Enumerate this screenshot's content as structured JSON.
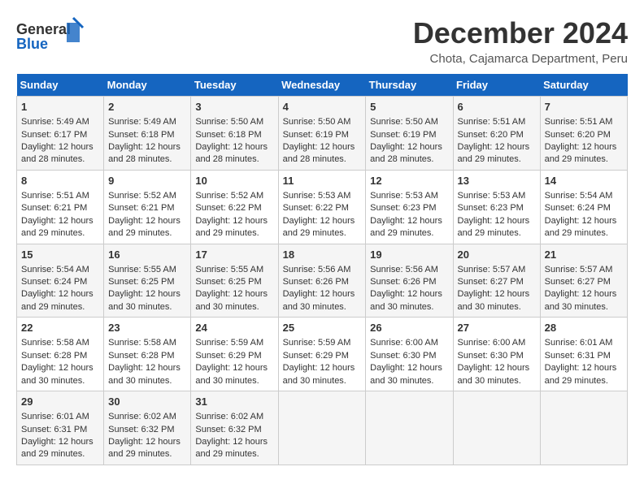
{
  "logo": {
    "general": "General",
    "blue": "Blue"
  },
  "title": "December 2024",
  "location": "Chota, Cajamarca Department, Peru",
  "days_of_week": [
    "Sunday",
    "Monday",
    "Tuesday",
    "Wednesday",
    "Thursday",
    "Friday",
    "Saturday"
  ],
  "weeks": [
    [
      {
        "day": "1",
        "sunrise": "5:49 AM",
        "sunset": "6:17 PM",
        "daylight": "12 hours and 28 minutes."
      },
      {
        "day": "2",
        "sunrise": "5:49 AM",
        "sunset": "6:18 PM",
        "daylight": "12 hours and 28 minutes."
      },
      {
        "day": "3",
        "sunrise": "5:50 AM",
        "sunset": "6:18 PM",
        "daylight": "12 hours and 28 minutes."
      },
      {
        "day": "4",
        "sunrise": "5:50 AM",
        "sunset": "6:19 PM",
        "daylight": "12 hours and 28 minutes."
      },
      {
        "day": "5",
        "sunrise": "5:50 AM",
        "sunset": "6:19 PM",
        "daylight": "12 hours and 28 minutes."
      },
      {
        "day": "6",
        "sunrise": "5:51 AM",
        "sunset": "6:20 PM",
        "daylight": "12 hours and 29 minutes."
      },
      {
        "day": "7",
        "sunrise": "5:51 AM",
        "sunset": "6:20 PM",
        "daylight": "12 hours and 29 minutes."
      }
    ],
    [
      {
        "day": "8",
        "sunrise": "5:51 AM",
        "sunset": "6:21 PM",
        "daylight": "12 hours and 29 minutes."
      },
      {
        "day": "9",
        "sunrise": "5:52 AM",
        "sunset": "6:21 PM",
        "daylight": "12 hours and 29 minutes."
      },
      {
        "day": "10",
        "sunrise": "5:52 AM",
        "sunset": "6:22 PM",
        "daylight": "12 hours and 29 minutes."
      },
      {
        "day": "11",
        "sunrise": "5:53 AM",
        "sunset": "6:22 PM",
        "daylight": "12 hours and 29 minutes."
      },
      {
        "day": "12",
        "sunrise": "5:53 AM",
        "sunset": "6:23 PM",
        "daylight": "12 hours and 29 minutes."
      },
      {
        "day": "13",
        "sunrise": "5:53 AM",
        "sunset": "6:23 PM",
        "daylight": "12 hours and 29 minutes."
      },
      {
        "day": "14",
        "sunrise": "5:54 AM",
        "sunset": "6:24 PM",
        "daylight": "12 hours and 29 minutes."
      }
    ],
    [
      {
        "day": "15",
        "sunrise": "5:54 AM",
        "sunset": "6:24 PM",
        "daylight": "12 hours and 29 minutes."
      },
      {
        "day": "16",
        "sunrise": "5:55 AM",
        "sunset": "6:25 PM",
        "daylight": "12 hours and 30 minutes."
      },
      {
        "day": "17",
        "sunrise": "5:55 AM",
        "sunset": "6:25 PM",
        "daylight": "12 hours and 30 minutes."
      },
      {
        "day": "18",
        "sunrise": "5:56 AM",
        "sunset": "6:26 PM",
        "daylight": "12 hours and 30 minutes."
      },
      {
        "day": "19",
        "sunrise": "5:56 AM",
        "sunset": "6:26 PM",
        "daylight": "12 hours and 30 minutes."
      },
      {
        "day": "20",
        "sunrise": "5:57 AM",
        "sunset": "6:27 PM",
        "daylight": "12 hours and 30 minutes."
      },
      {
        "day": "21",
        "sunrise": "5:57 AM",
        "sunset": "6:27 PM",
        "daylight": "12 hours and 30 minutes."
      }
    ],
    [
      {
        "day": "22",
        "sunrise": "5:58 AM",
        "sunset": "6:28 PM",
        "daylight": "12 hours and 30 minutes."
      },
      {
        "day": "23",
        "sunrise": "5:58 AM",
        "sunset": "6:28 PM",
        "daylight": "12 hours and 30 minutes."
      },
      {
        "day": "24",
        "sunrise": "5:59 AM",
        "sunset": "6:29 PM",
        "daylight": "12 hours and 30 minutes."
      },
      {
        "day": "25",
        "sunrise": "5:59 AM",
        "sunset": "6:29 PM",
        "daylight": "12 hours and 30 minutes."
      },
      {
        "day": "26",
        "sunrise": "6:00 AM",
        "sunset": "6:30 PM",
        "daylight": "12 hours and 30 minutes."
      },
      {
        "day": "27",
        "sunrise": "6:00 AM",
        "sunset": "6:30 PM",
        "daylight": "12 hours and 30 minutes."
      },
      {
        "day": "28",
        "sunrise": "6:01 AM",
        "sunset": "6:31 PM",
        "daylight": "12 hours and 29 minutes."
      }
    ],
    [
      {
        "day": "29",
        "sunrise": "6:01 AM",
        "sunset": "6:31 PM",
        "daylight": "12 hours and 29 minutes."
      },
      {
        "day": "30",
        "sunrise": "6:02 AM",
        "sunset": "6:32 PM",
        "daylight": "12 hours and 29 minutes."
      },
      {
        "day": "31",
        "sunrise": "6:02 AM",
        "sunset": "6:32 PM",
        "daylight": "12 hours and 29 minutes."
      },
      null,
      null,
      null,
      null
    ]
  ],
  "labels": {
    "sunrise": "Sunrise: ",
    "sunset": "Sunset: ",
    "daylight": "Daylight: "
  }
}
